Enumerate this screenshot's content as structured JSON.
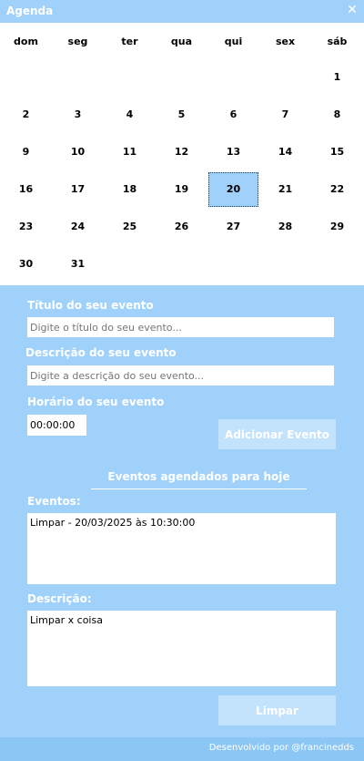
{
  "window": {
    "title": "Agenda",
    "close_glyph": "✕"
  },
  "calendar": {
    "weekdays": [
      "dom",
      "seg",
      "ter",
      "qua",
      "qui",
      "sex",
      "sáb"
    ],
    "weeks": [
      [
        "",
        "",
        "",
        "",
        "",
        "",
        "1"
      ],
      [
        "2",
        "3",
        "4",
        "5",
        "6",
        "7",
        "8"
      ],
      [
        "9",
        "10",
        "11",
        "12",
        "13",
        "14",
        "15"
      ],
      [
        "16",
        "17",
        "18",
        "19",
        "20",
        "21",
        "22"
      ],
      [
        "23",
        "24",
        "25",
        "26",
        "27",
        "28",
        "29"
      ],
      [
        "30",
        "31",
        "",
        "",
        "",
        "",
        ""
      ]
    ],
    "selected_day": "20",
    "selected_color": "#9fd1fa"
  },
  "form": {
    "title_label": "Título do seu evento",
    "title_placeholder": "Digite o título do seu evento...",
    "description_label": "Descrição do seu evento",
    "description_placeholder": "Digite a descrição do seu evento...",
    "time_label": "Horário do seu evento",
    "time_value": "00:00:00",
    "add_button": "Adicionar Evento"
  },
  "today": {
    "section_title": "Eventos agendados para hoje",
    "events_label": "Eventos:",
    "events": [
      "Limpar - 20/03/2025 às 10:30:00"
    ],
    "description_label": "Descrição:",
    "description_text": "Limpar x coisa",
    "clear_button": "Limpar"
  },
  "footer": {
    "credit": "Desenvolvido por @francinedds"
  },
  "colors": {
    "background": "#9fd1fa",
    "button": "#c3e2fc",
    "footer": "#8cc6f5"
  }
}
